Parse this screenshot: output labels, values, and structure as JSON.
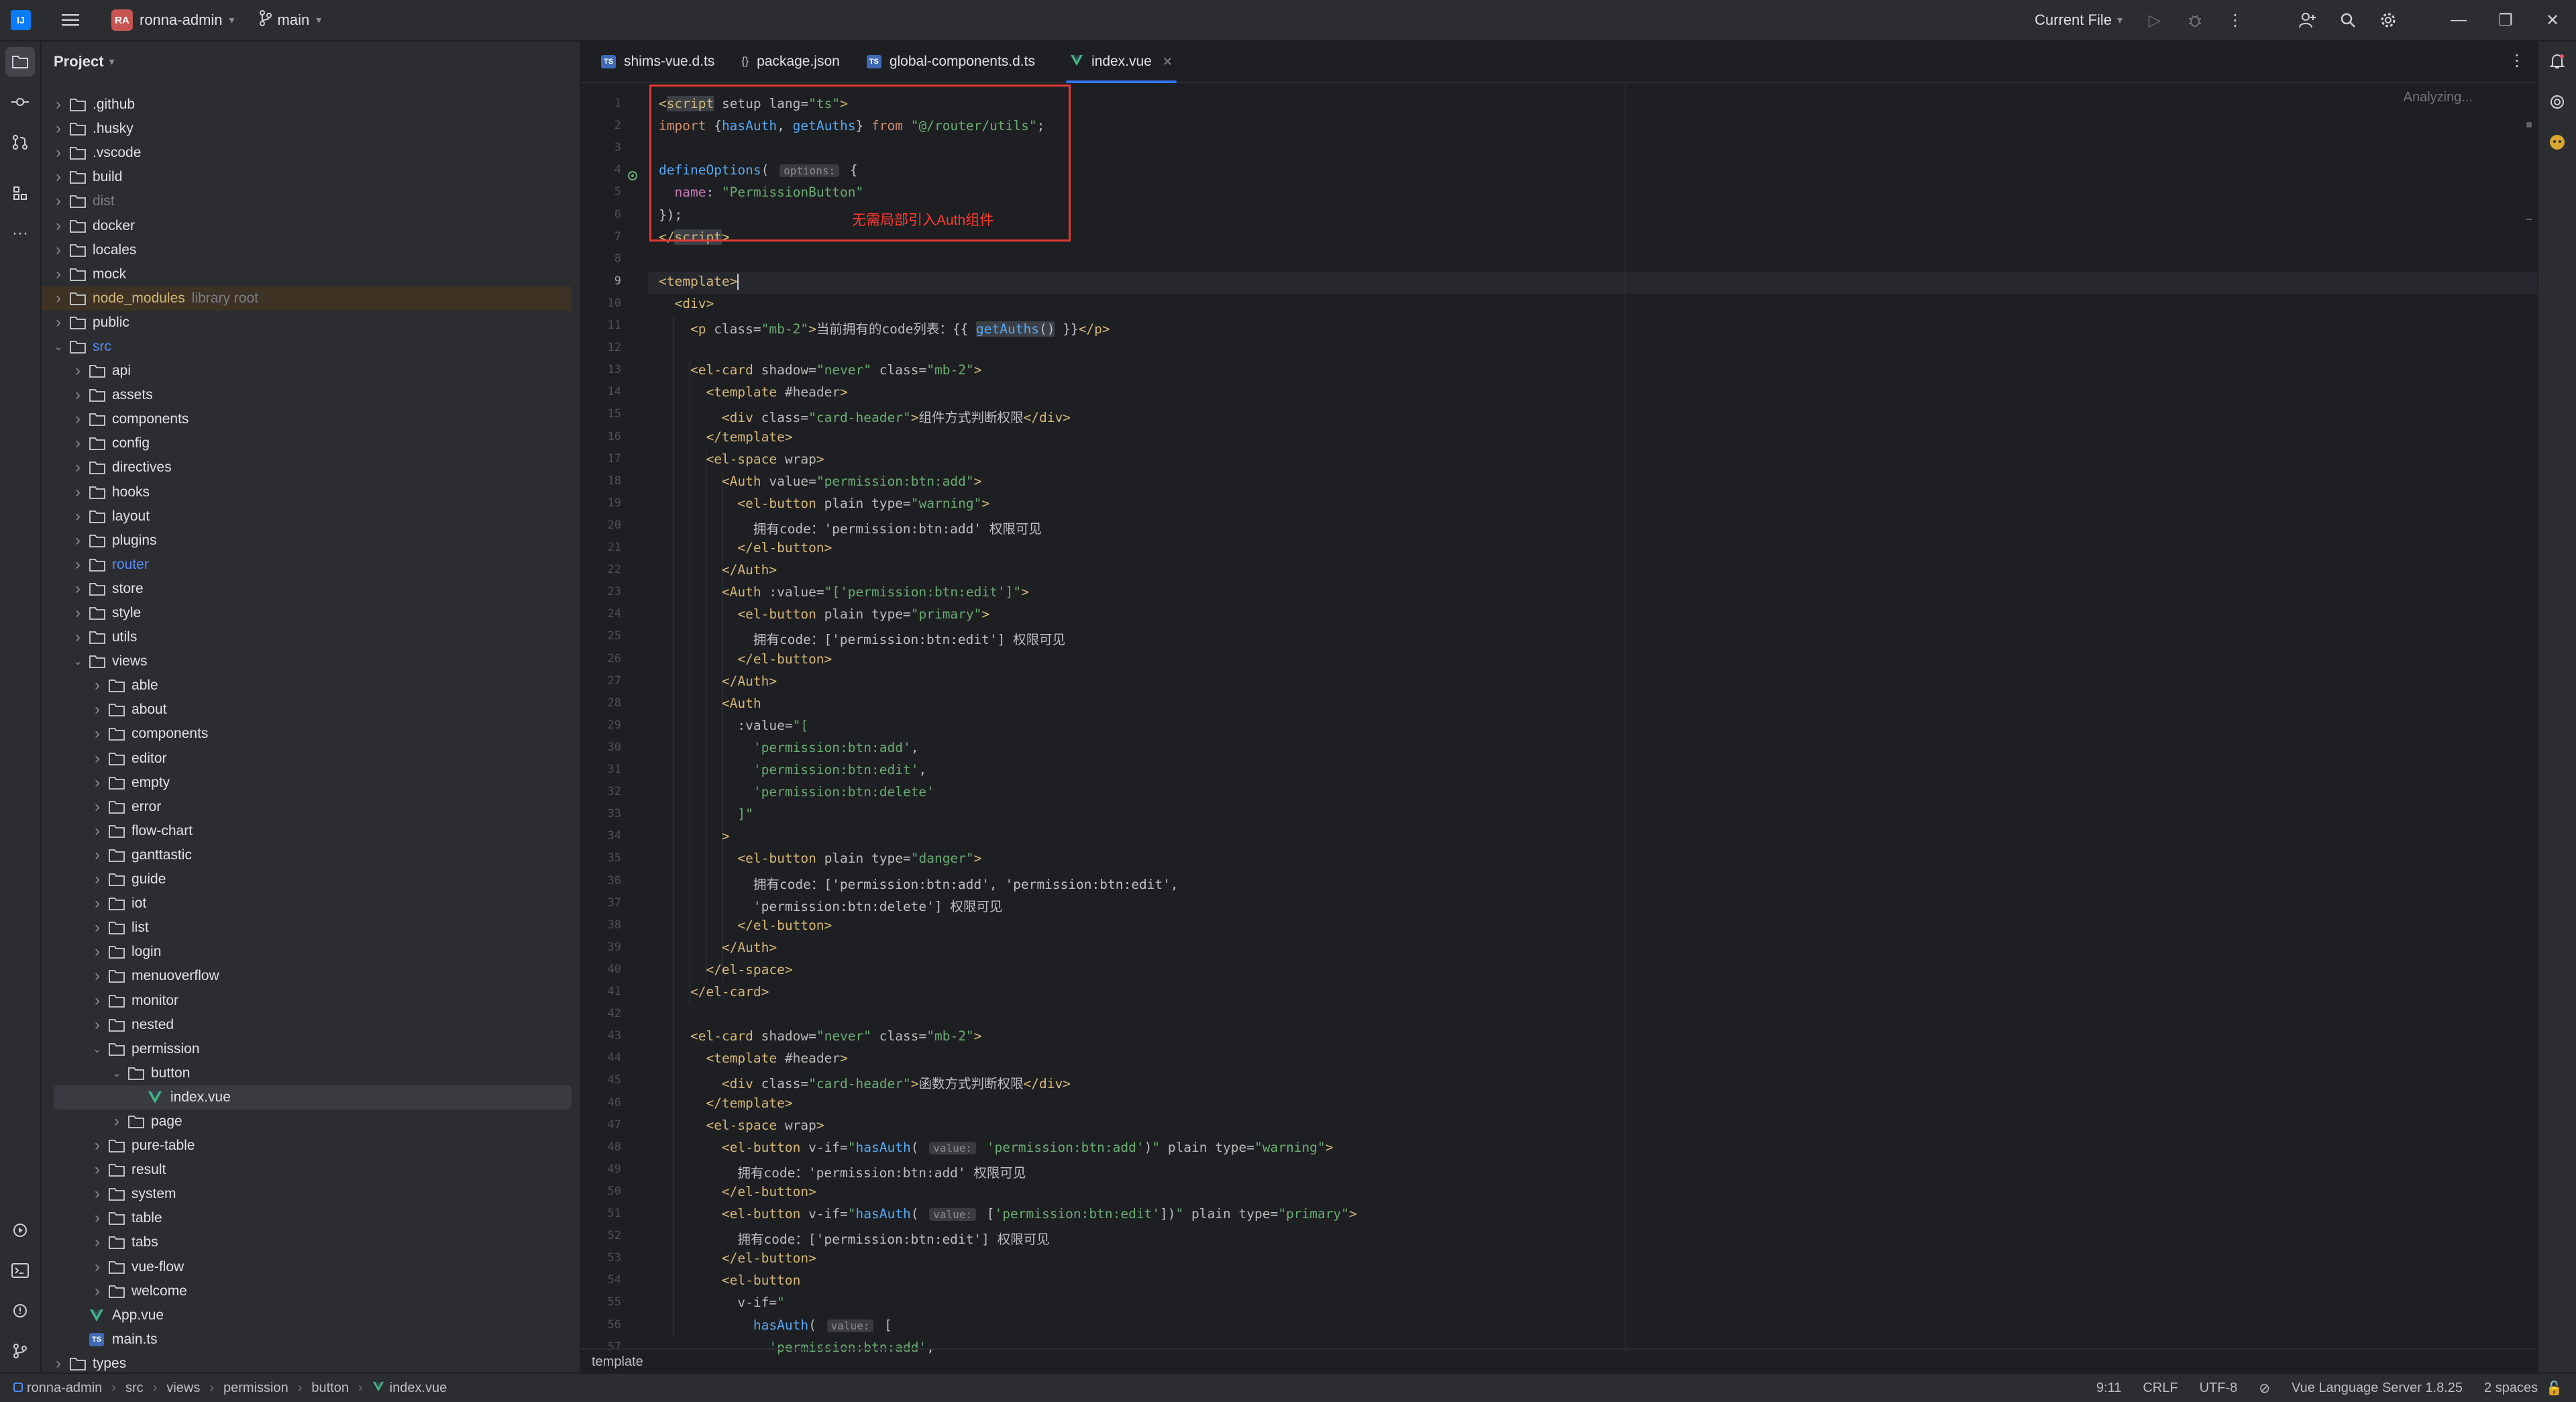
{
  "titlebar": {
    "project_badge": "RA",
    "project_name": "ronna-admin",
    "branch": "main",
    "run_config": "Current File"
  },
  "project_panel": {
    "title": "Project",
    "tree": [
      {
        "label": ".github",
        "depth": 1,
        "kind": "folder",
        "expanded": false
      },
      {
        "label": ".husky",
        "depth": 1,
        "kind": "folder",
        "expanded": false
      },
      {
        "label": ".vscode",
        "depth": 1,
        "kind": "folder",
        "expanded": false
      },
      {
        "label": "build",
        "depth": 1,
        "kind": "folder",
        "expanded": false
      },
      {
        "label": "dist",
        "depth": 1,
        "kind": "folder",
        "expanded": false,
        "style": "dim"
      },
      {
        "label": "docker",
        "depth": 1,
        "kind": "folder",
        "expanded": false
      },
      {
        "label": "locales",
        "depth": 1,
        "kind": "folder",
        "expanded": false
      },
      {
        "label": "mock",
        "depth": 1,
        "kind": "folder",
        "expanded": false
      },
      {
        "label": "node_modules",
        "depth": 1,
        "kind": "folder",
        "expanded": false,
        "style": "orange",
        "extra": "library root"
      },
      {
        "label": "public",
        "depth": 1,
        "kind": "folder",
        "expanded": false
      },
      {
        "label": "src",
        "depth": 1,
        "kind": "folder",
        "expanded": true,
        "style": "blue"
      },
      {
        "label": "api",
        "depth": 2,
        "kind": "folder",
        "expanded": false
      },
      {
        "label": "assets",
        "depth": 2,
        "kind": "folder",
        "expanded": false
      },
      {
        "label": "components",
        "depth": 2,
        "kind": "folder",
        "expanded": false
      },
      {
        "label": "config",
        "depth": 2,
        "kind": "folder",
        "expanded": false
      },
      {
        "label": "directives",
        "depth": 2,
        "kind": "folder",
        "expanded": false
      },
      {
        "label": "hooks",
        "depth": 2,
        "kind": "folder",
        "expanded": false
      },
      {
        "label": "layout",
        "depth": 2,
        "kind": "folder",
        "expanded": false
      },
      {
        "label": "plugins",
        "depth": 2,
        "kind": "folder",
        "expanded": false
      },
      {
        "label": "router",
        "depth": 2,
        "kind": "folder",
        "expanded": false,
        "style": "blue"
      },
      {
        "label": "store",
        "depth": 2,
        "kind": "folder",
        "expanded": false
      },
      {
        "label": "style",
        "depth": 2,
        "kind": "folder",
        "expanded": false
      },
      {
        "label": "utils",
        "depth": 2,
        "kind": "folder",
        "expanded": false
      },
      {
        "label": "views",
        "depth": 2,
        "kind": "folder",
        "expanded": true
      },
      {
        "label": "able",
        "depth": 3,
        "kind": "folder",
        "expanded": false
      },
      {
        "label": "about",
        "depth": 3,
        "kind": "folder",
        "expanded": false
      },
      {
        "label": "components",
        "depth": 3,
        "kind": "folder",
        "expanded": false
      },
      {
        "label": "editor",
        "depth": 3,
        "kind": "folder",
        "expanded": false
      },
      {
        "label": "empty",
        "depth": 3,
        "kind": "folder",
        "expanded": false
      },
      {
        "label": "error",
        "depth": 3,
        "kind": "folder",
        "expanded": false
      },
      {
        "label": "flow-chart",
        "depth": 3,
        "kind": "folder",
        "expanded": false
      },
      {
        "label": "ganttastic",
        "depth": 3,
        "kind": "folder",
        "expanded": false
      },
      {
        "label": "guide",
        "depth": 3,
        "kind": "folder",
        "expanded": false
      },
      {
        "label": "iot",
        "depth": 3,
        "kind": "folder",
        "expanded": false
      },
      {
        "label": "list",
        "depth": 3,
        "kind": "folder",
        "expanded": false
      },
      {
        "label": "login",
        "depth": 3,
        "kind": "folder",
        "expanded": false
      },
      {
        "label": "menuoverflow",
        "depth": 3,
        "kind": "folder",
        "expanded": false
      },
      {
        "label": "monitor",
        "depth": 3,
        "kind": "folder",
        "expanded": false
      },
      {
        "label": "nested",
        "depth": 3,
        "kind": "folder",
        "expanded": false
      },
      {
        "label": "permission",
        "depth": 3,
        "kind": "folder",
        "expanded": true
      },
      {
        "label": "button",
        "depth": 4,
        "kind": "folder",
        "expanded": true
      },
      {
        "label": "index.vue",
        "depth": 5,
        "kind": "vue",
        "selected": true
      },
      {
        "label": "page",
        "depth": 4,
        "kind": "folder",
        "expanded": false
      },
      {
        "label": "pure-table",
        "depth": 3,
        "kind": "folder",
        "expanded": false
      },
      {
        "label": "result",
        "depth": 3,
        "kind": "folder",
        "expanded": false
      },
      {
        "label": "system",
        "depth": 3,
        "kind": "folder",
        "expanded": false
      },
      {
        "label": "table",
        "depth": 3,
        "kind": "folder",
        "expanded": false
      },
      {
        "label": "tabs",
        "depth": 3,
        "kind": "folder",
        "expanded": false
      },
      {
        "label": "vue-flow",
        "depth": 3,
        "kind": "folder",
        "expanded": false
      },
      {
        "label": "welcome",
        "depth": 3,
        "kind": "folder",
        "expanded": false
      },
      {
        "label": "App.vue",
        "depth": 2,
        "kind": "vue"
      },
      {
        "label": "main.ts",
        "depth": 2,
        "kind": "ts"
      },
      {
        "label": "types",
        "depth": 1,
        "kind": "folder",
        "expanded": false
      }
    ]
  },
  "editor": {
    "tabs": [
      {
        "label": "shims-vue.d.ts",
        "icon": "ts-icon",
        "active": false
      },
      {
        "label": "package.json",
        "icon": "json-icon",
        "active": false
      },
      {
        "label": "global-components.d.ts",
        "icon": "ts-icon",
        "active": false
      },
      {
        "label": "index.vue",
        "icon": "vue-icon",
        "active": true
      }
    ],
    "status_text": "Analyzing...",
    "annotation": "无需局部引入Auth组件",
    "context_breadcrumb": "template",
    "code_lines": [
      "<span class='t'>&lt;</span><span class='t hl'>script</span> <span class='a'>setup</span> <span class='a'>lang</span>=<span class='s'>\"ts\"</span><span class='t'>&gt;</span>",
      "<span class='k'>import</span> {<span class='f'>hasAuth</span>, <span class='f'>getAuths</span>} <span class='k'>from</span> <span class='s'>\"@/router/utils\"</span>;",
      "",
      "<span class='f'>defineOptions</span>( <span class='hint'>options:</span> {",
      "  <span class='p'>name</span>: <span class='s'>\"PermissionButton\"</span>",
      "});",
      "<span class='t'>&lt;/</span><span class='t hl'>script</span><span class='t'>&gt;</span>",
      "",
      "<span class='t'>&lt;template&gt;</span><span class='cur'></span>",
      "  <span class='t'>&lt;div&gt;</span>",
      "    <span class='t'>&lt;p</span> <span class='a'>class</span>=<span class='s'>\"mb-2\"</span><span class='t'>&gt;</span>当前拥有的code列表：{{ <span class='hl'><span class='f'>getAuths</span>()</span> }}<span class='t'>&lt;/p&gt;</span>",
      "",
      "    <span class='t'>&lt;el-card</span> <span class='a'>shadow</span>=<span class='s'>\"never\"</span> <span class='a'>class</span>=<span class='s'>\"mb-2\"</span><span class='t'>&gt;</span>",
      "      <span class='t'>&lt;template</span> <span class='a'>#header</span><span class='t'>&gt;</span>",
      "        <span class='t'>&lt;div</span> <span class='a'>class</span>=<span class='s'>\"card-header\"</span><span class='t'>&gt;</span>组件方式判断权限<span class='t'>&lt;/div&gt;</span>",
      "      <span class='t'>&lt;/template&gt;</span>",
      "      <span class='t'>&lt;el-space</span> <span class='a'>wrap</span><span class='t'>&gt;</span>",
      "        <span class='t'>&lt;Auth</span> <span class='a'>value</span>=<span class='s'>\"permission:btn:add\"</span><span class='t'>&gt;</span>",
      "          <span class='t'>&lt;el-button</span> <span class='a'>plain</span> <span class='a'>type</span>=<span class='s'>\"warning\"</span><span class='t'>&gt;</span>",
      "            拥有code：'permission:btn:add' 权限可见",
      "          <span class='t'>&lt;/el-button&gt;</span>",
      "        <span class='t'>&lt;/Auth&gt;</span>",
      "        <span class='t'>&lt;Auth</span> <span class='a'>:value</span>=<span class='s'>\"[</span><span class='s'>'permission:btn:edit'</span><span class='s'>]\"</span><span class='t'>&gt;</span>",
      "          <span class='t'>&lt;el-button</span> <span class='a'>plain</span> <span class='a'>type</span>=<span class='s'>\"primary\"</span><span class='t'>&gt;</span>",
      "            拥有code：['permission:btn:edit'] 权限可见",
      "          <span class='t'>&lt;/el-button&gt;</span>",
      "        <span class='t'>&lt;/Auth&gt;</span>",
      "        <span class='t'>&lt;Auth</span>",
      "          <span class='a'>:value</span>=<span class='s'>\"[</span>",
      "            <span class='s'>'permission:btn:add'</span>,",
      "            <span class='s'>'permission:btn:edit'</span>,",
      "            <span class='s'>'permission:btn:delete'</span>",
      "          <span class='s'>]\"</span>",
      "        <span class='t'>&gt;</span>",
      "          <span class='t'>&lt;el-button</span> <span class='a'>plain</span> <span class='a'>type</span>=<span class='s'>\"danger\"</span><span class='t'>&gt;</span>",
      "            拥有code：['permission:btn:add', 'permission:btn:edit',",
      "            'permission:btn:delete'] 权限可见",
      "          <span class='t'>&lt;/el-button&gt;</span>",
      "        <span class='t'>&lt;/Auth&gt;</span>",
      "      <span class='t'>&lt;/el-space&gt;</span>",
      "    <span class='t'>&lt;/el-card&gt;</span>",
      "",
      "    <span class='t'>&lt;el-card</span> <span class='a'>shadow</span>=<span class='s'>\"never\"</span> <span class='a'>class</span>=<span class='s'>\"mb-2\"</span><span class='t'>&gt;</span>",
      "      <span class='t'>&lt;template</span> <span class='a'>#header</span><span class='t'>&gt;</span>",
      "        <span class='t'>&lt;div</span> <span class='a'>class</span>=<span class='s'>\"card-header\"</span><span class='t'>&gt;</span>函数方式判断权限<span class='t'>&lt;/div&gt;</span>",
      "      <span class='t'>&lt;/template&gt;</span>",
      "      <span class='t'>&lt;el-space</span> <span class='a'>wrap</span><span class='t'>&gt;</span>",
      "        <span class='t'>&lt;el-button</span> <span class='a'>v-if</span>=<span class='s'>\"</span><span class='f'>hasAuth</span>( <span class='hint'>value:</span> <span class='s'>'permission:btn:add'</span>)<span class='s'>\"</span> <span class='a'>plain</span> <span class='a'>type</span>=<span class='s'>\"warning\"</span><span class='t'>&gt;</span>",
      "          拥有code：'permission:btn:add' 权限可见",
      "        <span class='t'>&lt;/el-button&gt;</span>",
      "        <span class='t'>&lt;el-button</span> <span class='a'>v-if</span>=<span class='s'>\"</span><span class='f'>hasAuth</span>( <span class='hint'>value:</span> [<span class='s'>'permission:btn:edit'</span>])<span class='s'>\"</span> <span class='a'>plain</span> <span class='a'>type</span>=<span class='s'>\"primary\"</span><span class='t'>&gt;</span>",
      "          拥有code：['permission:btn:edit'] 权限可见",
      "        <span class='t'>&lt;/el-button&gt;</span>",
      "        <span class='t'>&lt;el-button</span>",
      "          <span class='a'>v-if</span>=<span class='s'>\"</span>",
      "            <span class='f'>hasAuth</span>( <span class='hint'>value:</span> [",
      "              <span class='s'>'permission:btn:add'</span>,"
    ]
  },
  "statusbar": {
    "crumbs": [
      "ronna-admin",
      "src",
      "views",
      "permission",
      "button",
      "index.vue"
    ],
    "position": "9:11",
    "line_sep": "CRLF",
    "encoding": "UTF-8",
    "language_server": "Vue Language Server 1.8.25",
    "indent": "2 spaces"
  },
  "colors": {
    "accent": "#3574f0",
    "annotation_red": "#e53935",
    "vue_green": "#41b883"
  }
}
